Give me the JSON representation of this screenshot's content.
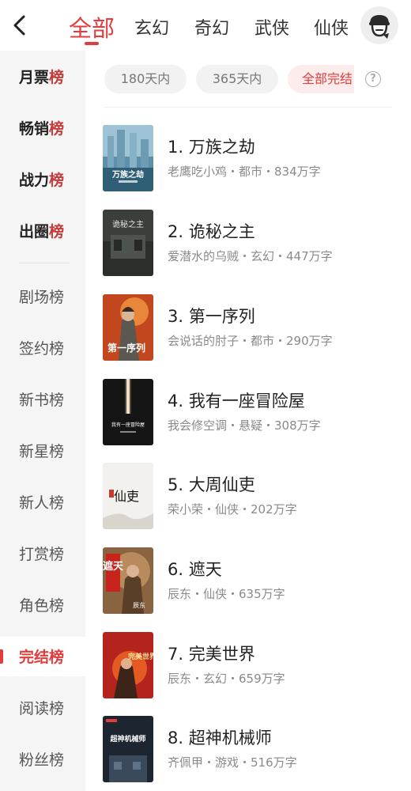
{
  "header": {
    "categories": [
      {
        "label": "全部"
      },
      {
        "label": "玄幻"
      },
      {
        "label": "奇幻"
      },
      {
        "label": "武侠"
      },
      {
        "label": "仙侠"
      }
    ]
  },
  "sidebar": {
    "items": [
      {
        "label_a": "月票",
        "label_b": "榜"
      },
      {
        "label_a": "畅销",
        "label_b": "榜"
      },
      {
        "label_a": "战力",
        "label_b": "榜"
      },
      {
        "label_a": "出圈",
        "label_b": "榜"
      },
      {
        "label": "剧场榜"
      },
      {
        "label": "签约榜"
      },
      {
        "label": "新书榜"
      },
      {
        "label": "新星榜"
      },
      {
        "label": "新人榜"
      },
      {
        "label": "打赏榜"
      },
      {
        "label": "角色榜"
      },
      {
        "label": "完结榜"
      },
      {
        "label": "阅读榜"
      },
      {
        "label": "粉丝榜"
      }
    ],
    "active_label": "完结榜"
  },
  "filters": {
    "chips": [
      {
        "label": "180天内"
      },
      {
        "label": "365天内"
      },
      {
        "label": "全部完结"
      }
    ],
    "help_label": "?"
  },
  "books": [
    {
      "title": "1. 万族之劫",
      "meta": "老鹰吃小鸡・都市・834万字",
      "cover_text": "万族之劫"
    },
    {
      "title": "2. 诡秘之主",
      "meta": "爱潜水的乌贼・玄幻・447万字",
      "cover_text": "诡秘之主"
    },
    {
      "title": "3. 第一序列",
      "meta": "会说话的肘子・都市・290万字",
      "cover_text": "第一序列"
    },
    {
      "title": "4. 我有一座冒险屋",
      "meta": "我会修空调・悬疑・308万字",
      "cover_text": "我有一座冒险屋"
    },
    {
      "title": "5. 大周仙吏",
      "meta": "荣小荣・仙侠・202万字",
      "cover_text": "仙吏"
    },
    {
      "title": "6. 遮天",
      "meta": "辰东・仙侠・635万字",
      "cover_text": "遮天",
      "cover_author": "辰东"
    },
    {
      "title": "7. 完美世界",
      "meta": "辰东・玄幻・659万字",
      "cover_text": "完美世界"
    },
    {
      "title": "8. 超神机械师",
      "meta": "齐佩甲・游戏・516万字",
      "cover_text": "超神机械师"
    }
  ],
  "colors": {
    "accent": "#e23c3c",
    "sidebar_bg": "#f5f5f5",
    "chip_bg": "#f2f2f2",
    "chip_active_bg": "#fdecec"
  },
  "icons": {
    "back": "chevron-left-icon",
    "avatar": "user-avatar-icon",
    "help": "question-circle-icon"
  }
}
